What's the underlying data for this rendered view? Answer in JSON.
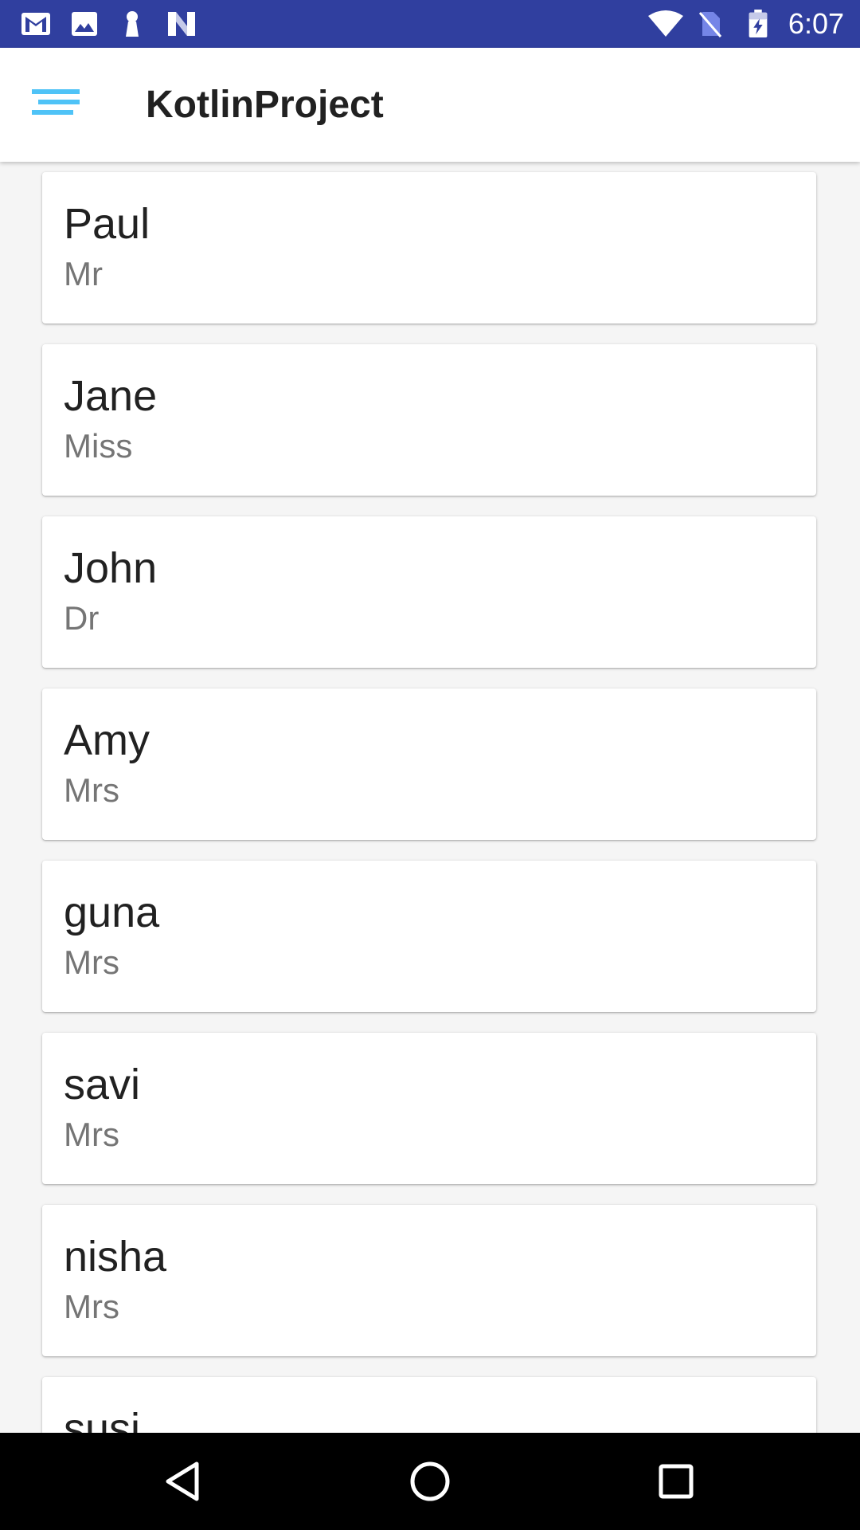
{
  "status_bar": {
    "time": "6:07",
    "left_icons": [
      "gmail-icon",
      "image-icon",
      "keyhole-icon",
      "n-logo-icon"
    ],
    "right_icons": [
      "wifi-icon",
      "no-sim-icon",
      "battery-charging-icon"
    ],
    "background": "#303f9f"
  },
  "app_bar": {
    "title": "KotlinProject",
    "menu_icon": "sort-menu-icon",
    "accent": "#4fc3f7"
  },
  "list": {
    "items": [
      {
        "name": "Paul",
        "title": "Mr"
      },
      {
        "name": "Jane",
        "title": "Miss"
      },
      {
        "name": "John",
        "title": "Dr"
      },
      {
        "name": "Amy",
        "title": "Mrs"
      },
      {
        "name": "guna",
        "title": "Mrs"
      },
      {
        "name": "savi",
        "title": "Mrs"
      },
      {
        "name": "nisha",
        "title": "Mrs"
      },
      {
        "name": "susi",
        "title": ""
      }
    ]
  },
  "nav_bar": {
    "icons": [
      "back-icon",
      "home-icon",
      "recents-icon"
    ]
  }
}
